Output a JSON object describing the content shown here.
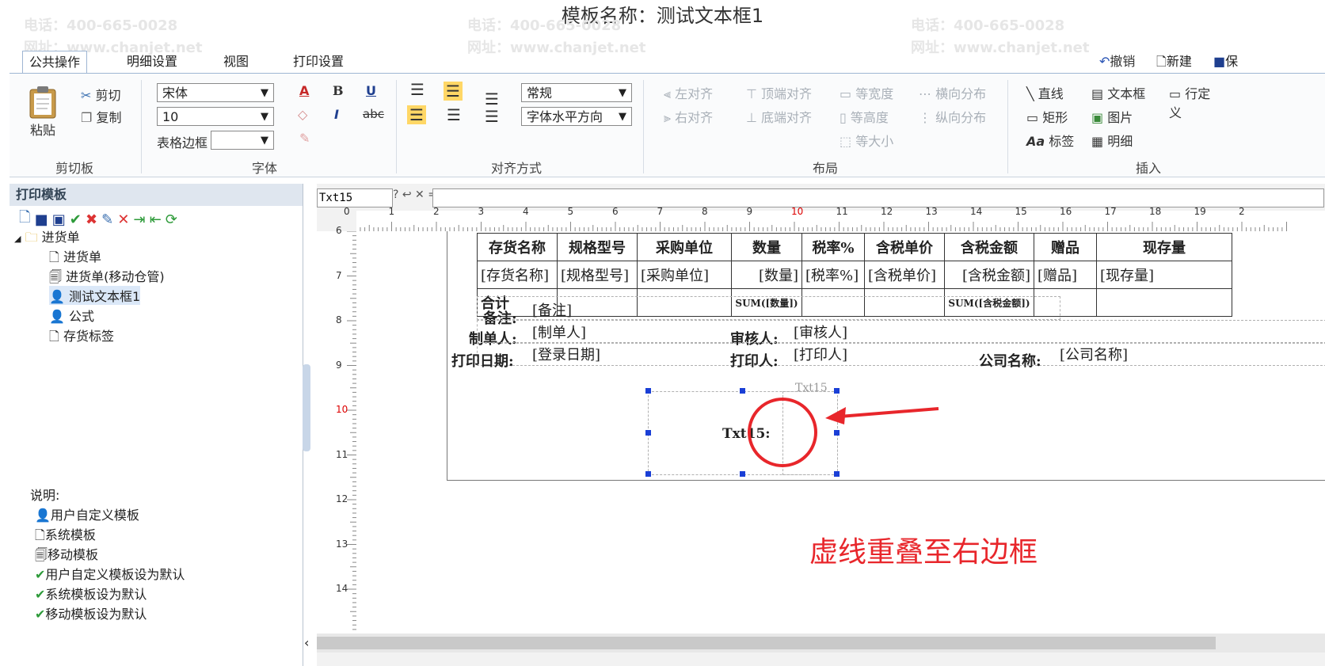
{
  "title": "模板名称：测试文本框1",
  "watermark": {
    "phone": "电话：400-665-0028",
    "site": "网址：www.chanjet.net"
  },
  "ribbon": {
    "tabs": [
      "公共操作",
      "明细设置",
      "视图",
      "打印设置"
    ],
    "quick": {
      "undo": "撤销",
      "new": "新建",
      "save": "保"
    },
    "clipboard": {
      "paste": "粘贴",
      "cut": "剪切",
      "copy": "复制",
      "group": "剪切板"
    },
    "font": {
      "name": "宋体",
      "size": "10",
      "border_label": "表格边框",
      "group": "字体"
    },
    "align": {
      "mode": "常规",
      "direction": "字体水平方向",
      "group": "对齐方式"
    },
    "layout": {
      "left": "左对齐",
      "right": "右对齐",
      "top": "顶端对齐",
      "bottom": "底端对齐",
      "same_width": "等宽度",
      "same_height": "等高度",
      "same_size": "等大小",
      "h_dist": "横向分布",
      "v_dist": "纵向分布",
      "group": "布局"
    },
    "insert": {
      "line": "直线",
      "textbox": "文本框",
      "custom": "行定义",
      "rect": "矩形",
      "image": "图片",
      "label": "标签",
      "detail": "明细",
      "group": "插入"
    }
  },
  "left": {
    "header": "打印模板",
    "tree": {
      "root": "进货单",
      "items": [
        "进货单",
        "进货单(移动仓管)",
        "测试文本框1",
        "公式",
        "存货标签"
      ]
    },
    "legend": {
      "title": "说明:",
      "items": [
        "用户自定义模板",
        "系统模板",
        "移动模板",
        "用户自定义模板设为默认",
        "系统模板设为默认",
        "移动模板设为默认"
      ]
    }
  },
  "formula": {
    "name": "Txt15",
    "symbols": "? ↩ ✕ ="
  },
  "ruler": {
    "h": [
      "0",
      "1",
      "2",
      "3",
      "4",
      "5",
      "6",
      "7",
      "8",
      "9",
      "10",
      "11",
      "12",
      "13",
      "14",
      "15",
      "16",
      "17",
      "18",
      "19",
      "2"
    ],
    "v": [
      "6",
      "7",
      "8",
      "9",
      "10",
      "11",
      "12",
      "13",
      "14"
    ]
  },
  "table": {
    "headers": [
      "存货名称",
      "规格型号",
      "采购单位",
      "数量",
      "税率%",
      "含税单价",
      "含税金额",
      "赠品",
      "现存量"
    ],
    "fields": [
      "[存货名称]",
      "[规格型号]",
      "[采购单位]",
      "[数量]",
      "[税率%]",
      "[含税单价]",
      "[含税金额]",
      "[赠品]",
      "[现存量]"
    ],
    "total": {
      "label": "合计",
      "qty": "SUM([数量])",
      "amount": "SUM([含税金额])"
    }
  },
  "footer": {
    "remark_label": "备注:",
    "remark": "[备注]",
    "maker_label": "制单人:",
    "maker": "[制单人]",
    "auditor_label": "审核人:",
    "auditor": "[审核人]",
    "date_label": "打印日期:",
    "date": "[登录日期]",
    "printer_label": "打印人:",
    "printer": "[打印人]",
    "company_label": "公司名称:",
    "company": "[公司名称]"
  },
  "textbox": {
    "name": "Txt15",
    "label": "Txt15:"
  },
  "annotation": "虚线重叠至右边框",
  "colors": {
    "accent": "#1a3fd6",
    "annotation": "#e8262b"
  }
}
